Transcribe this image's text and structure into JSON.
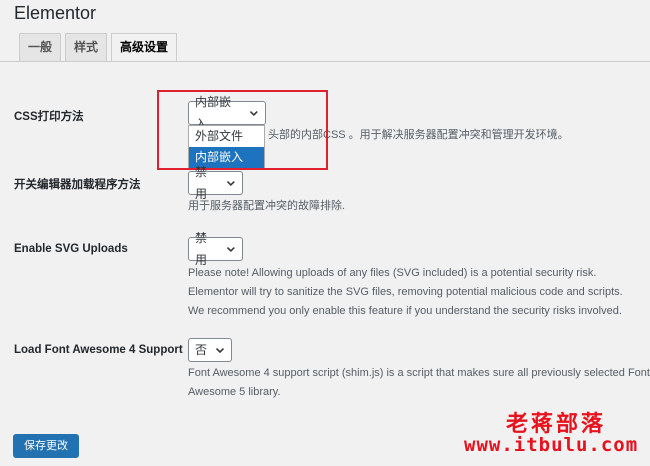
{
  "page": {
    "title": "Elementor"
  },
  "tabs": [
    {
      "label": "一般",
      "active": false
    },
    {
      "label": "样式",
      "active": false
    },
    {
      "label": "高级设置",
      "active": true
    }
  ],
  "css_print": {
    "label": "CSS打印方法",
    "selected": "内部嵌入",
    "desc_visible": "头部的内部CSS 。用于解决服务器配置冲突和管理开发环境。",
    "options": [
      "外部文件",
      "内部嵌入"
    ]
  },
  "editor_loader": {
    "label": "开关编辑器加载程序方法",
    "selected": "禁用",
    "desc": "用于服务器配置冲突的故障排除."
  },
  "svg_uploads": {
    "label": "Enable SVG Uploads",
    "selected": "禁用",
    "desc_lines": [
      "Please note! Allowing uploads of any files (SVG included) is a potential security risk.",
      "Elementor will try to sanitize the SVG files, removing potential malicious code and scripts.",
      "We recommend you only enable this feature if you understand the security risks involved."
    ]
  },
  "font_awesome": {
    "label": "Load Font Awesome 4 Support",
    "selected": "否",
    "desc_lines": [
      "Font Awesome 4 support script (shim.js) is a script that makes sure all previously selected Font",
      "Awesome 5 library."
    ]
  },
  "save_button": {
    "label": "保存更改"
  },
  "watermark": {
    "name": "老蒋部落",
    "url": "www.itbulu.com"
  },
  "colors": {
    "accent": "#2271b1",
    "highlight": "#e0202f",
    "watermark": "#e8121d"
  },
  "icons": {
    "chevron": "chevron-down-icon"
  }
}
